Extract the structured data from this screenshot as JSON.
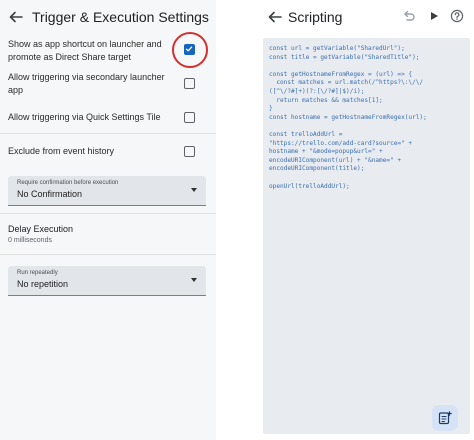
{
  "left": {
    "title": "Trigger & Execution Settings",
    "options": [
      {
        "label_line1": "Show as app shortcut on launcher and",
        "label_line2": "promote as Direct Share target",
        "checked": true
      },
      {
        "label_line1": "Allow triggering via secondary launcher",
        "label_line2": "app",
        "checked": false
      },
      {
        "label_line1": "Allow triggering via Quick Settings Tile",
        "checked": false
      },
      {
        "label_line1": "Exclude from event history",
        "checked": false
      }
    ],
    "confirmation": {
      "label": "Require confirmation before execution",
      "value": "No Confirmation"
    },
    "delay": {
      "title": "Delay Execution",
      "value": "0 milliseconds"
    },
    "repeat": {
      "label": "Run repeatedly",
      "value": "No repetition"
    }
  },
  "right": {
    "title": "Scripting",
    "code": "const url = getVariable(\"SharedUrl\");\nconst title = getVariable(\"SharedTitle\");\n\nconst getHostnameFromRegex = (url) => {\n  const matches = url.match(/^https?\\:\\/\\/\n([^\\/?#]+)(?:[\\/?#]|$)/i);\n  return matches && matches[1];\n}\nconst hostname = getHostnameFromRegex(url);\n\nconst trelloAddUrl =\n\"https://trello.com/add-card?source=\" +\nhostname + \"&mode=popup&url=\" +\nencodeURIComponent(url) + \"&name=\" +\nencodeURIComponent(title);\n\nopenUrl(trelloAddUrl);"
  },
  "colors": {
    "accent": "#1565c0",
    "highlight_ring": "#d32f2f",
    "code_bg": "#e8ebef",
    "code_text": "#3a6fb0"
  },
  "icons": [
    "back-arrow-icon",
    "undo-icon",
    "play-icon",
    "help-icon",
    "add-snippet-icon",
    "checkmark-icon"
  ]
}
